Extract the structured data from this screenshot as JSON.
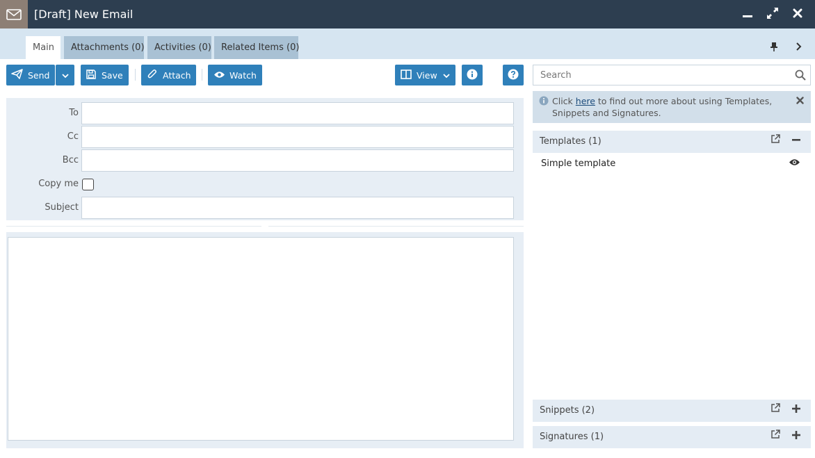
{
  "window": {
    "title": "[Draft] New Email",
    "icons": {
      "app": "envelope-icon",
      "minimize": "minimize-icon",
      "maximize": "expand-icon",
      "close": "close-icon"
    }
  },
  "tabs": [
    {
      "label": "Main",
      "active": true
    },
    {
      "label": "Attachments (0)",
      "active": false
    },
    {
      "label": "Activities (0)",
      "active": false
    },
    {
      "label": "Related Items (0)",
      "active": false
    }
  ],
  "tab_controls": {
    "pin": "pin-icon",
    "next": "chevron-right-icon"
  },
  "toolbar": {
    "send_label": "Send",
    "save_label": "Save",
    "attach_label": "Attach",
    "watch_label": "Watch",
    "view_label": "View"
  },
  "form": {
    "to_label": "To",
    "to_value": "",
    "cc_label": "Cc",
    "cc_value": "",
    "bcc_label": "Bcc",
    "bcc_value": "",
    "copy_me_label": "Copy me",
    "copy_me_checked": false,
    "subject_label": "Subject",
    "subject_value": ""
  },
  "sidebar": {
    "search_placeholder": "Search",
    "info": {
      "prefix": "Click ",
      "link": "here",
      "suffix": " to find out more about using Templates, Snippets and Signatures."
    },
    "templates": {
      "title": "Templates (1)",
      "items": [
        "Simple template"
      ]
    },
    "snippets": {
      "title": "Snippets (2)"
    },
    "signatures": {
      "title": "Signatures (1)"
    }
  },
  "colors": {
    "titlebar": "#2d3e50",
    "app_icon_bg": "#8d7f75",
    "tabbar": "#d6e5f1",
    "tab_inactive": "#a9c1d4",
    "button": "#2f80ba",
    "panel": "#e7eef5"
  }
}
